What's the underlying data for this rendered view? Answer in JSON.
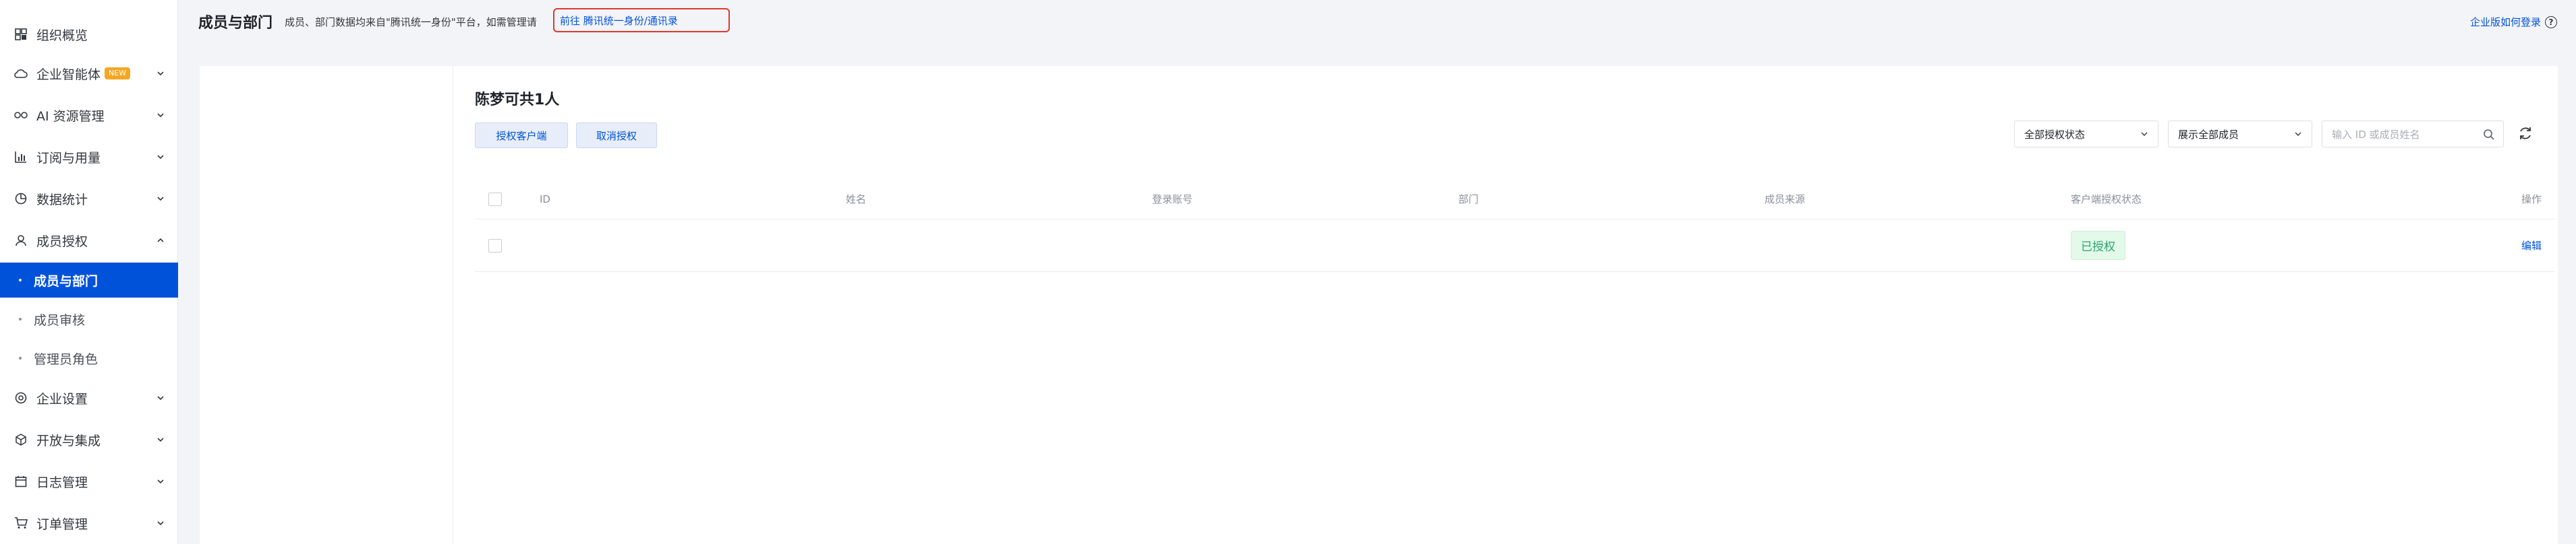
{
  "sidebar": {
    "items": [
      {
        "label": "组织概览",
        "icon": "grid-icon"
      },
      {
        "label": "企业智能体",
        "icon": "cloud-icon",
        "badge": "NEW"
      },
      {
        "label": "AI 资源管理",
        "icon": "infinity-icon"
      },
      {
        "label": "订阅与用量",
        "icon": "bar-chart-icon"
      },
      {
        "label": "数据统计",
        "icon": "pie-chart-icon"
      },
      {
        "label": "成员授权",
        "icon": "user-icon"
      },
      {
        "label": "企业设置",
        "icon": "settings-icon"
      },
      {
        "label": "开放与集成",
        "icon": "cube-icon"
      },
      {
        "label": "日志管理",
        "icon": "calendar-icon"
      },
      {
        "label": "订单管理",
        "icon": "cart-icon"
      }
    ],
    "sub_items": [
      {
        "label": "成员与部门"
      },
      {
        "label": "成员审核"
      },
      {
        "label": "管理员角色"
      }
    ]
  },
  "header": {
    "title": "成员与部门",
    "description": "成员、部门数据均来自\"腾讯统一身份\"平台，如需管理请",
    "link": "前往 腾讯统一身份/通讯录",
    "right_link": "企业版如何登录"
  },
  "main": {
    "member_title": "陈梦可共1人",
    "buttons": {
      "authorize": "授权客户端",
      "revoke": "取消授权"
    },
    "filters": {
      "auth_status": "全部授权状态",
      "members": "展示全部成员",
      "search_placeholder": "输入 ID 或成员姓名"
    },
    "table": {
      "columns": [
        "ID",
        "姓名",
        "登录账号",
        "部门",
        "成员来源",
        "客户端授权状态",
        "操作"
      ],
      "rows": [
        {
          "id": "",
          "name": "",
          "account": "",
          "department": "",
          "source": "",
          "status": "已授权",
          "action": "编辑"
        }
      ]
    }
  },
  "colors": {
    "accent": "#0052d9",
    "highlight_border": "#e0392b",
    "status_green": "#2ba471",
    "badge": "#f5a623"
  }
}
